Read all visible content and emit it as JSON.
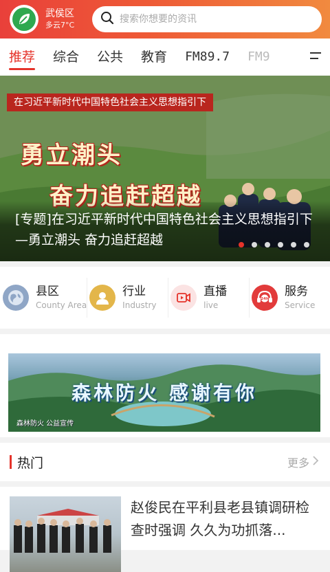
{
  "header": {
    "city": "武侯区",
    "weather": "多云7°C",
    "search_placeholder": "搜索你想要的资讯"
  },
  "tabs": [
    {
      "label": "推荐",
      "active": true
    },
    {
      "label": "综合"
    },
    {
      "label": "公共"
    },
    {
      "label": "教育"
    },
    {
      "label": "FM89.7"
    },
    {
      "label": "FM9"
    }
  ],
  "banner": {
    "ribbon": "在习近平新时代中国特色社会主义思想指引下",
    "slogan_line1": "勇立潮头",
    "slogan_line2": "奋力追赶超越",
    "caption": "[专题]在习近平新时代中国特色社会主义思想指引下—勇立潮头  奋力追赶超越",
    "slide_count": 6,
    "active_slide": 1
  },
  "categories": [
    {
      "title": "县区",
      "subtitle": "County Area",
      "icon": "globe-icon",
      "color": "#8fa6c6"
    },
    {
      "title": "行业",
      "subtitle": "Industry",
      "icon": "person-icon",
      "color": "#e3b64a"
    },
    {
      "title": "直播",
      "subtitle": "live",
      "icon": "video-icon",
      "color": "#f3c2c2"
    },
    {
      "title": "服务",
      "subtitle": "Service",
      "icon": "24h-service-icon",
      "color": "#e23b3b"
    }
  ],
  "ad": {
    "title": "森林防火 感谢有你",
    "footer": "森林防火 公益宣传"
  },
  "hot": {
    "title": "热门",
    "more": "更多"
  },
  "news": [
    {
      "title": "赵俊民在平利县老县镇调研检查时强调 久久为功抓落..."
    }
  ],
  "colors": {
    "accent": "#e5332a",
    "header_gradient_start": "#e9403a",
    "header_gradient_end": "#f18a3f"
  }
}
